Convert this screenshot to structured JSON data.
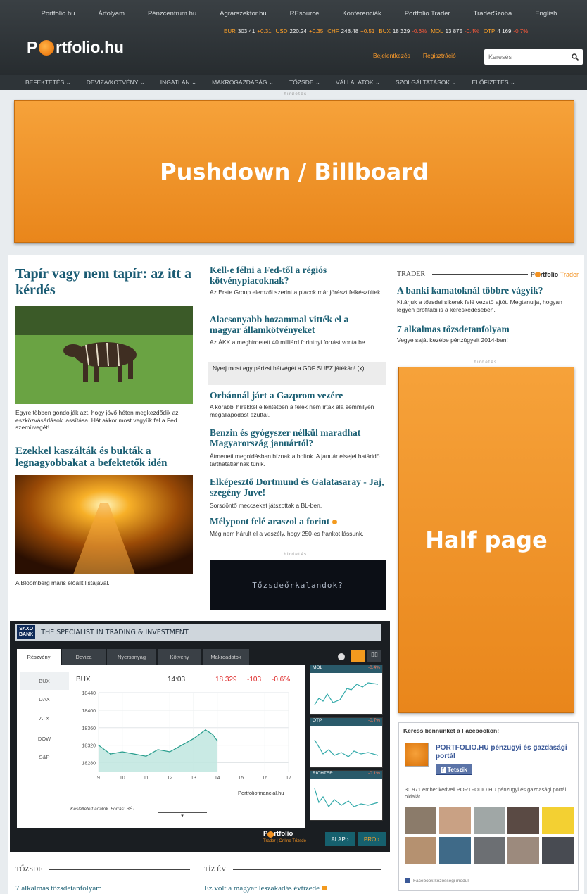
{
  "top_sites": [
    "Portfolio.hu",
    "Árfolyam",
    "Pénzcentrum.hu",
    "Agrárszektor.hu",
    "REsource",
    "Konferenciák",
    "Portfolio Trader",
    "TraderSzoba",
    "English"
  ],
  "logo": {
    "pre": "P",
    "post": "rtfolio.hu"
  },
  "ticker": [
    {
      "n": "EUR",
      "v": "303.41",
      "c": "+0.31",
      "dir": "up"
    },
    {
      "n": "USD",
      "v": "220.24",
      "c": "+0.35",
      "dir": "up"
    },
    {
      "n": "CHF",
      "v": "248.48",
      "c": "+0.51",
      "dir": "up"
    },
    {
      "n": "BUX",
      "v": "18 329",
      "c": "-0.6%",
      "dir": "dn"
    },
    {
      "n": "MOL",
      "v": "13 875",
      "c": "-0.4%",
      "dir": "dn"
    },
    {
      "n": "OTP",
      "v": "4 169",
      "c": "-0.7%",
      "dir": "dn"
    }
  ],
  "header_links": [
    "Bejelentkezés",
    "Regisztráció"
  ],
  "search": {
    "placeholder": "Keresés"
  },
  "nav": [
    "BEFEKTETÉS ⌄",
    "DEVIZA/KÖTVÉNY ⌄",
    "INGATLAN ⌄",
    "MAKROGAZDASÁG ⌄",
    "TŐZSDE ⌄",
    "VÁLLALATOK ⌄",
    "SZOLGÁLTATÁSOK ⌄",
    "ELŐFIZETÉS ⌄"
  ],
  "ad_label": "hirdetés",
  "billboard": "Pushdown / Billboard",
  "halfpage": "Half page",
  "lead": {
    "title": "Tapír vagy nem tapír: az itt a kérdés",
    "text": "Egyre többen gondolják azt, hogy jövő héten megkezdődik az eszközvásárlások lassítása. Hát akkor most vegyük fel a Fed szemüvegét!"
  },
  "second": {
    "title": "Ezekkel kaszálták és bukták a legnagyobbakat a befektetők idén",
    "text": "A Bloomberg máris előállt listájával."
  },
  "middle": [
    {
      "title": "Kell-e félni a Fed-től a régiós kötvénypiacoknak?",
      "text": "Az Erste Group elemzői szerint a piacok már jórészt felkészültek."
    },
    {
      "title": "Alacsonyabb hozammal vitték el a magyar államkötvényeket",
      "text": "Az ÁKK a meghirdetett 40 milliárd forintnyi forrást vonta be."
    },
    {
      "title": "Orbánnál járt a Gazprom vezére",
      "text": "A korábbi hírekkel ellentétben a felek nem írtak alá semmilyen megállapodást ezúttal."
    },
    {
      "title": "Benzin és gyógyszer nélkül maradhat Magyarország januártól?",
      "text": "Átmeneti megoldásban bíznak a boltok. A január elsejei határidő tarthatatlannak tűnik."
    },
    {
      "title": "Elképesztő Dortmund és Galatasaray - Jaj, szegény Juve!",
      "text": "Sorsdöntő meccseket játszottak a BL-ben."
    },
    {
      "title": "Mélypont felé araszol a forint",
      "text": "Még nem hárult el a veszély, hogy 250-es frankot lássunk."
    }
  ],
  "promo": "Nyerj most egy párizsi hétvégét a GDF SUEZ játékán! (x)",
  "dark_ad": "Tőzsdeőrkalandok?",
  "trader": {
    "section": "TRADER",
    "brand_pre": "P",
    "brand_post": "rtfolio",
    "brand_trader": "Trader",
    "items": [
      {
        "title": "A banki kamatoknál többre vágyik?",
        "text": "Kitárjuk a tőzsdei sikerek felé vezető ajtót. Megtanulja, hogyan legyen profitábilis a kereskedésében."
      },
      {
        "title": "7 alkalmas tőzsdetanfolyam",
        "text": "Vegye saját kezébe pénzügyeit 2014-ben!"
      }
    ]
  },
  "widget": {
    "brand_top": "SAXO",
    "brand_bottom": "BANK",
    "tagline": "THE SPECIALIST IN TRADING & INVESTMENT",
    "tabs": [
      "Részvény",
      "Deviza",
      "Nyersanyag",
      "Kötvény",
      "Makroadatok"
    ],
    "side": [
      "BUX",
      "DAX",
      "ATX",
      "DOW",
      "S&P"
    ],
    "quote": {
      "name": "BUX",
      "time": "14:03",
      "value": "18 329",
      "change": "-103",
      "pct": "-0.6%"
    },
    "source": "Portfoliofinancial.hu",
    "note": "Késleltetett adatok. Forrás: BÉT.",
    "minis": [
      {
        "name": "MOL",
        "chg": "-0.4%"
      },
      {
        "name": "OTP",
        "chg": "-0.7%"
      },
      {
        "name": "RICHTER",
        "chg": "-0.1%"
      }
    ],
    "logo_pre": "P",
    "logo_post": "rtfolio",
    "logo_sub": "Trader | Online Tőzsde",
    "btn_alap": "ALAP ›",
    "btn_pro": "PRO ›"
  },
  "chart_data": {
    "type": "area",
    "title": "BUX",
    "xlabel": "",
    "ylabel": "",
    "x": [
      9,
      9.5,
      10,
      10.5,
      11,
      11.5,
      12,
      12.5,
      13,
      13.5,
      13.8,
      14
    ],
    "values": [
      18320,
      18300,
      18305,
      18300,
      18295,
      18310,
      18305,
      18320,
      18335,
      18355,
      18345,
      18330
    ],
    "ylim": [
      18260,
      18440
    ],
    "yticks": [
      18280,
      18320,
      18360,
      18400,
      18440
    ],
    "xticks": [
      9,
      10,
      11,
      12,
      13,
      14,
      15,
      16,
      17
    ],
    "xlim": [
      9,
      17
    ]
  },
  "facebook": {
    "title": "Keress bennünket a Facebookon!",
    "page": "PORTFOLIO.HU pénzügyi és gazdasági portál",
    "like": "Tetszik",
    "count_text": "30.971 ember kedveli PORTFOLIO.HU pénzügyi és gazdasági portál oldalát",
    "plugin": "Facebook közösségi modul"
  },
  "sections_bottom": [
    {
      "name": "TŐZSDE",
      "first": "7 alkalmas tőzsdetanfolyam"
    },
    {
      "name": "TÍZ ÉV",
      "first": "Ez volt a magyar leszakadás évtizede"
    }
  ]
}
